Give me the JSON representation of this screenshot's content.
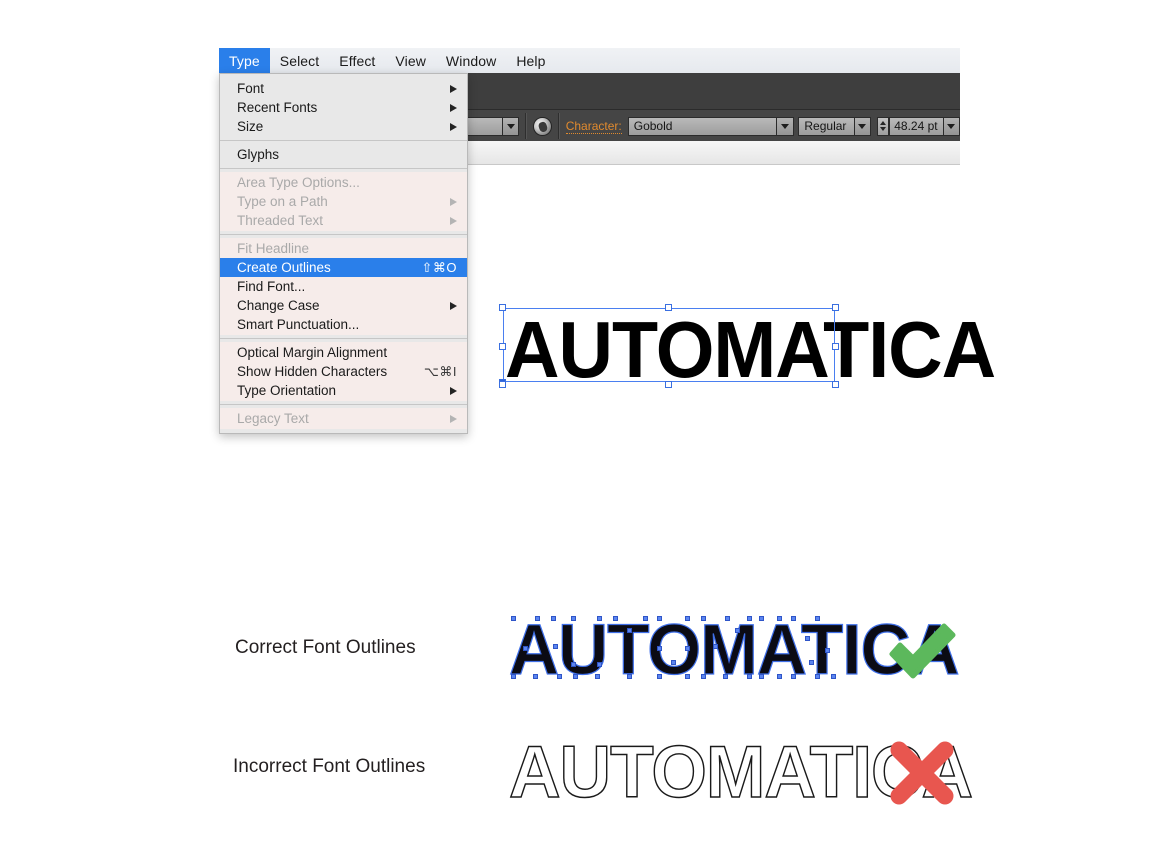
{
  "app": {
    "menubar": [
      {
        "label": "Type",
        "active": true
      },
      {
        "label": "Select",
        "active": false
      },
      {
        "label": "Effect",
        "active": false
      },
      {
        "label": "View",
        "active": false
      },
      {
        "label": "Window",
        "active": false
      },
      {
        "label": "Help",
        "active": false
      }
    ],
    "toolbar": {
      "fill_dropdown_icon": "chevron-down-icon",
      "swatch_icon": "appearance-swatch-icon",
      "character_label": "Character:",
      "font_family_value": "Gobold",
      "font_style_value": "Regular",
      "font_size_value": "48.24 pt",
      "accent_color": "#e08a2e",
      "panel_bg": "#3e3e3e"
    }
  },
  "type_menu": {
    "highlight_color": "#2a7fea",
    "sections": [
      {
        "tint": "gray",
        "items": [
          {
            "label": "Font",
            "shortcut": "",
            "submenu": true,
            "disabled": false,
            "selected": false
          },
          {
            "label": "Recent Fonts",
            "shortcut": "",
            "submenu": true,
            "disabled": false,
            "selected": false
          },
          {
            "label": "Size",
            "shortcut": "",
            "submenu": true,
            "disabled": false,
            "selected": false
          }
        ]
      },
      {
        "tint": "gray",
        "items": [
          {
            "label": "Glyphs",
            "shortcut": "",
            "submenu": false,
            "disabled": false,
            "selected": false
          }
        ]
      },
      {
        "tint": "warm",
        "items": [
          {
            "label": "Area Type Options...",
            "shortcut": "",
            "submenu": false,
            "disabled": true,
            "selected": false
          },
          {
            "label": "Type on a Path",
            "shortcut": "",
            "submenu": true,
            "disabled": true,
            "selected": false
          },
          {
            "label": "Threaded Text",
            "shortcut": "",
            "submenu": true,
            "disabled": true,
            "selected": false
          }
        ]
      },
      {
        "tint": "warm",
        "items": [
          {
            "label": "Fit Headline",
            "shortcut": "",
            "submenu": false,
            "disabled": true,
            "selected": false
          },
          {
            "label": "Create Outlines",
            "shortcut": "⇧⌘O",
            "submenu": false,
            "disabled": false,
            "selected": true
          },
          {
            "label": "Find Font...",
            "shortcut": "",
            "submenu": false,
            "disabled": false,
            "selected": false
          },
          {
            "label": "Change Case",
            "shortcut": "",
            "submenu": true,
            "disabled": false,
            "selected": false
          },
          {
            "label": "Smart Punctuation...",
            "shortcut": "",
            "submenu": false,
            "disabled": false,
            "selected": false
          }
        ]
      },
      {
        "tint": "warm",
        "items": [
          {
            "label": "Optical Margin Alignment",
            "shortcut": "",
            "submenu": false,
            "disabled": false,
            "selected": false
          },
          {
            "label": "Show Hidden Characters",
            "shortcut": "⌥⌘I",
            "submenu": false,
            "disabled": false,
            "selected": false
          },
          {
            "label": "Type Orientation",
            "shortcut": "",
            "submenu": true,
            "disabled": false,
            "selected": false
          }
        ]
      },
      {
        "tint": "warm",
        "items": [
          {
            "label": "Legacy Text",
            "shortcut": "",
            "submenu": true,
            "disabled": true,
            "selected": false
          }
        ]
      }
    ]
  },
  "artboard": {
    "selected_text": "AUTOMATICA",
    "selection_color": "#4a7ff0"
  },
  "comparison": {
    "rows": [
      {
        "label": "Correct Font Outlines",
        "sample_text": "AUTOMATICA",
        "style": "outlined-with-anchor-points",
        "status_icon": "check-icon",
        "status_color": "#5cb85c"
      },
      {
        "label": "Incorrect Font Outlines",
        "sample_text": "AUTOMATICA",
        "style": "stroke-only-hollow",
        "status_icon": "cross-icon",
        "status_color": "#e8564f"
      }
    ]
  }
}
